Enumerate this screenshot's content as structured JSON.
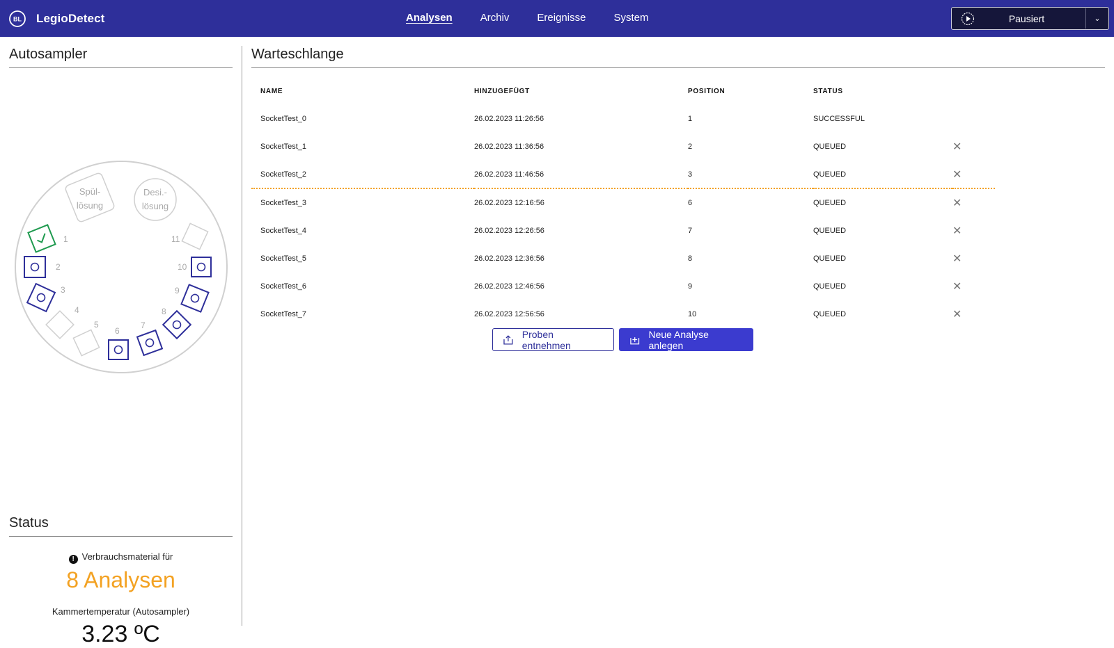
{
  "app": {
    "name": "LegioDetect"
  },
  "nav": {
    "items": [
      "Analysen",
      "Archiv",
      "Ereignisse",
      "System"
    ],
    "active": "Analysen"
  },
  "run_control": {
    "label": "Pausiert"
  },
  "autosampler": {
    "title": "Autosampler",
    "rinse_label": [
      "Spül-",
      "lösung"
    ],
    "desinfect_label": [
      "Desi.-",
      "lösung"
    ],
    "slot_numbers": [
      "1",
      "2",
      "3",
      "4",
      "5",
      "6",
      "7",
      "8",
      "9",
      "10",
      "11"
    ]
  },
  "status": {
    "title": "Status",
    "consumables_text": "Verbrauchsmaterial für",
    "analyses_left": "8 Analysen",
    "temp_label": "Kammertemperatur (Autosampler)",
    "temp_value": "3.23 ºC"
  },
  "queue": {
    "title": "Warteschlange",
    "columns": [
      "NAME",
      "HINZUGEFÜGT",
      "POSITION",
      "STATUS"
    ],
    "rows": [
      {
        "name": "SocketTest_0",
        "added": "26.02.2023 11:26:56",
        "position": "1",
        "status": "SUCCESSFUL"
      },
      {
        "name": "SocketTest_1",
        "added": "26.02.2023 11:36:56",
        "position": "2",
        "status": "QUEUED"
      },
      {
        "name": "SocketTest_2",
        "added": "26.02.2023 11:46:56",
        "position": "3",
        "status": "QUEUED"
      },
      {
        "name": "SocketTest_3",
        "added": "26.02.2023 12:16:56",
        "position": "6",
        "status": "QUEUED"
      },
      {
        "name": "SocketTest_4",
        "added": "26.02.2023 12:26:56",
        "position": "7",
        "status": "QUEUED"
      },
      {
        "name": "SocketTest_5",
        "added": "26.02.2023 12:36:56",
        "position": "8",
        "status": "QUEUED"
      },
      {
        "name": "SocketTest_6",
        "added": "26.02.2023 12:46:56",
        "position": "9",
        "status": "QUEUED"
      },
      {
        "name": "SocketTest_7",
        "added": "26.02.2023 12:56:56",
        "position": "10",
        "status": "QUEUED"
      }
    ]
  },
  "actions": {
    "take_samples": "Proben entnehmen",
    "new_analysis": "Neue Analyse anlegen"
  },
  "colors": {
    "brand": "#2e2f9a",
    "primary_button": "#3b3bcf",
    "success": "#1f9a4f",
    "accent": "#f3a223"
  }
}
